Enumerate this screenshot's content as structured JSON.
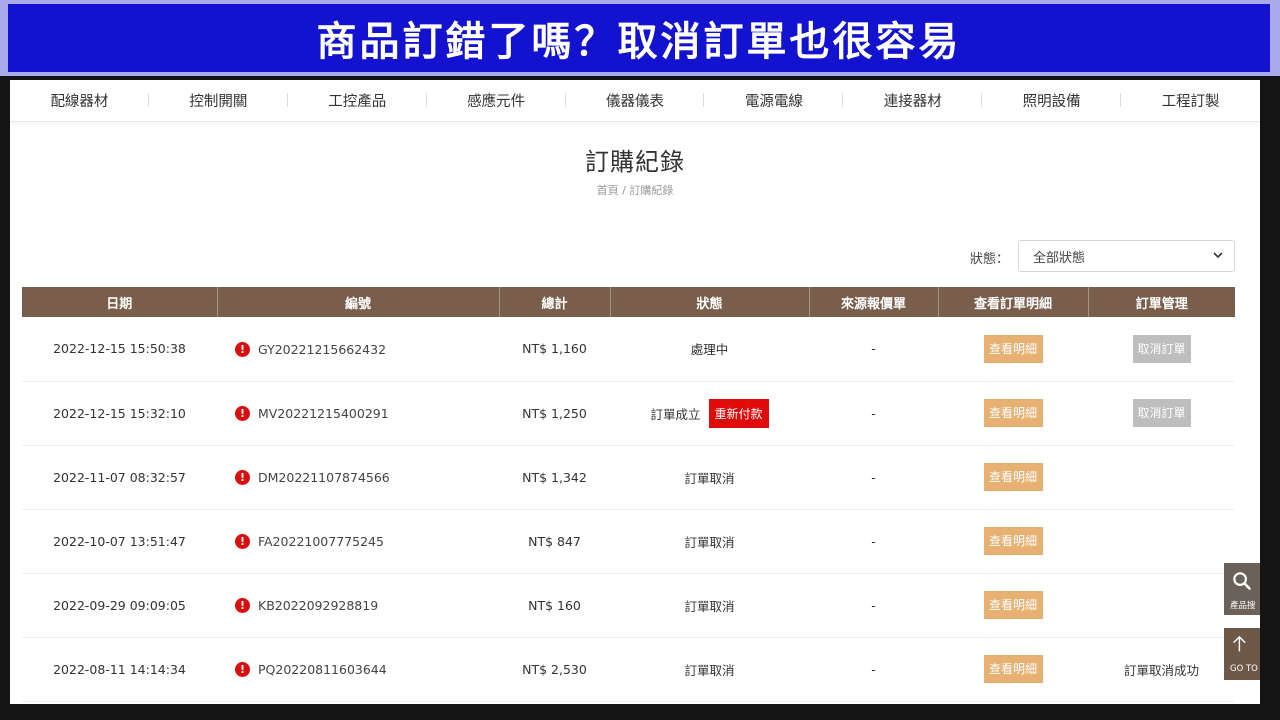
{
  "banner": {
    "title": "商品訂錯了嗎？取消訂單也很容易"
  },
  "nav": [
    "配線器材",
    "控制開關",
    "工控產品",
    "感應元件",
    "儀器儀表",
    "電源電線",
    "連接器材",
    "照明設備",
    "工程訂製"
  ],
  "page": {
    "title": "訂購紀錄",
    "breadcrumb": {
      "home": "首頁",
      "sep": "/",
      "current": "訂購紀錄"
    }
  },
  "filter": {
    "label": "狀態：",
    "selected": "全部狀態"
  },
  "table": {
    "headers": [
      "日期",
      "編號",
      "總計",
      "狀態",
      "來源報價單",
      "查看訂單明細",
      "訂單管理"
    ],
    "rows": [
      {
        "date": "2022-12-15 15:50:38",
        "id": "GY20221215662432",
        "total": "NT$ 1,160",
        "status": "處理中",
        "repay": "",
        "source": "-",
        "detail": "查看明細",
        "manage": "取消訂單",
        "manage_type": "button"
      },
      {
        "date": "2022-12-15 15:32:10",
        "id": "MV20221215400291",
        "total": "NT$ 1,250",
        "status": "訂單成立",
        "repay": "重新付款",
        "source": "-",
        "detail": "查看明細",
        "manage": "取消訂單",
        "manage_type": "button"
      },
      {
        "date": "2022-11-07 08:32:57",
        "id": "DM20221107874566",
        "total": "NT$ 1,342",
        "status": "訂單取消",
        "repay": "",
        "source": "-",
        "detail": "查看明細",
        "manage": "",
        "manage_type": "none"
      },
      {
        "date": "2022-10-07 13:51:47",
        "id": "FA20221007775245",
        "total": "NT$ 847",
        "status": "訂單取消",
        "repay": "",
        "source": "-",
        "detail": "查看明細",
        "manage": "",
        "manage_type": "none"
      },
      {
        "date": "2022-09-29 09:09:05",
        "id": "KB2022092928819",
        "total": "NT$ 160",
        "status": "訂單取消",
        "repay": "",
        "source": "-",
        "detail": "查看明細",
        "manage": "",
        "manage_type": "none"
      },
      {
        "date": "2022-08-11 14:14:34",
        "id": "PQ20220811603644",
        "total": "NT$ 2,530",
        "status": "訂單取消",
        "repay": "",
        "source": "-",
        "detail": "查看明細",
        "manage": "訂單取消成功",
        "manage_type": "text"
      }
    ]
  },
  "floating": {
    "search_label": "產品搜",
    "top_label": "GO TO"
  },
  "colors": {
    "banner_bg": "#1212cf",
    "header_bg": "#795e4c",
    "detail_btn": "#e6b172",
    "repay_btn": "#e00b0b",
    "cancel_btn": "#bebebe"
  },
  "icons": {
    "alert": "alert-circle-icon",
    "search": "search-icon",
    "up": "arrow-up-icon",
    "chevron": "chevron-down-icon"
  }
}
